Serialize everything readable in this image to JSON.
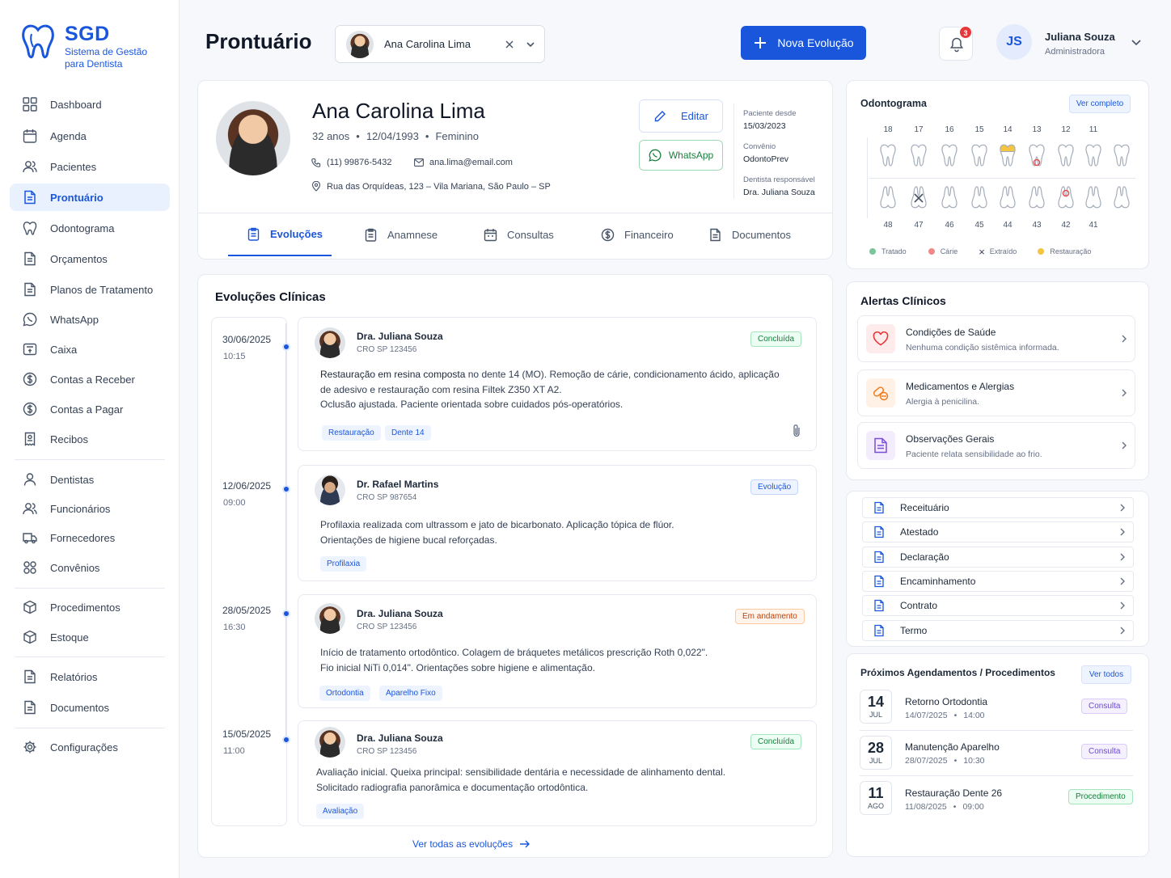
{
  "app": {
    "name": "SGD",
    "tagline_1": "Sistema de Gestão",
    "tagline_2": "para Dentista"
  },
  "sidebar": {
    "items": [
      {
        "label": "Dashboard",
        "icon": "grid-icon"
      },
      {
        "label": "Agenda",
        "icon": "calendar-icon"
      },
      {
        "label": "Pacientes",
        "icon": "users-icon"
      },
      {
        "label": "Prontuário",
        "icon": "file-icon",
        "active": true
      },
      {
        "label": "Odontograma",
        "icon": "tooth-icon"
      },
      {
        "label": "Orçamentos",
        "icon": "file-icon"
      },
      {
        "label": "Planos de Tratamento",
        "icon": "file-icon"
      },
      {
        "label": "WhatsApp",
        "icon": "whatsapp-icon"
      },
      {
        "label": "Caixa",
        "icon": "cash-icon"
      },
      {
        "label": "Contas a Receber",
        "icon": "dollar-icon"
      },
      {
        "label": "Contas a Pagar",
        "icon": "dollar-icon"
      },
      {
        "label": "Recibos",
        "icon": "receipt-icon"
      },
      {
        "label": "Dentistas",
        "icon": "user-icon"
      },
      {
        "label": "Funcionários",
        "icon": "users-icon"
      },
      {
        "label": "Fornecedores",
        "icon": "truck-icon"
      },
      {
        "label": "Convênios",
        "icon": "handshake-icon"
      },
      {
        "label": "Procedimentos",
        "icon": "box-icon"
      },
      {
        "label": "Estoque",
        "icon": "box-icon"
      },
      {
        "label": "Relatórios",
        "icon": "file-icon"
      },
      {
        "label": "Documentos",
        "icon": "file-icon"
      },
      {
        "label": "Configurações",
        "icon": "gear-icon"
      }
    ]
  },
  "header": {
    "title": "Prontuário",
    "patient_select": "Ana Carolina Lima",
    "new_button": "Nova Evolução",
    "notif_count": "3",
    "user_initials": "JS",
    "user_name": "Juliana Souza",
    "user_role": "Administradora"
  },
  "patient": {
    "name": "Ana Carolina Lima",
    "age": "32 anos",
    "birth": "12/04/1993",
    "gender": "Feminino",
    "phone": "(11) 99876-5432",
    "email": "ana.lima@email.com",
    "address": "Rua das Orquídeas, 123 – Vila Mariana, São Paulo – SP",
    "edit_label": "Editar",
    "whatsapp_label": "WhatsApp",
    "since_label": "Paciente desde",
    "since": "15/03/2023",
    "insurance_label": "Convênio",
    "insurance": "OdontoPrev",
    "dentist_label": "Dentista responsável",
    "dentist": "Dra. Juliana Souza"
  },
  "tabs": [
    "Evoluções",
    "Anamnese",
    "Consultas",
    "Financeiro",
    "Documentos"
  ],
  "evolutions": {
    "title": "Evoluções Clínicas",
    "items": [
      {
        "date": "30/06/2025",
        "time": "10:15",
        "doctor": "Dra. Juliana Souza",
        "cro": "CRO SP 123456",
        "status": "Concluída",
        "text_bold": "Restauração em resina composta",
        "line1": " no dente 14 (MO). Remoção de cárie, condicionamento ácido, aplicação",
        "line2": "de adesivo e restauração com resina Filtek Z350 XT A2.",
        "line3": "Oclusão ajustada. Paciente orientada sobre cuidados pós-operatórios.",
        "tags": [
          "Restauração",
          "Dente 14"
        ]
      },
      {
        "date": "12/06/2025",
        "time": "09:00",
        "doctor": "Dr. Rafael Martins",
        "cro": "CRO SP 987654",
        "status": "Evolução",
        "line1": "Profilaxia realizada com ultrassom e jato de bicarbonato. Aplicação tópica de flúor.",
        "line2": "Orientações de higiene bucal reforçadas.",
        "tags": [
          "Profilaxia"
        ]
      },
      {
        "date": "28/05/2025",
        "time": "16:30",
        "doctor": "Dra. Juliana Souza",
        "cro": "CRO SP 123456",
        "status": "Em andamento",
        "line1": "Início de tratamento ortodôntico. Colagem de bráquetes metálicos prescrição Roth 0,022\".",
        "line2": "Fio inicial NiTi 0,014\". Orientações sobre higiene e alimentação.",
        "tags": [
          "Ortodontia",
          "Aparelho Fixo"
        ]
      },
      {
        "date": "15/05/2025",
        "time": "11:00",
        "doctor": "Dra. Juliana Souza",
        "cro": "CRO SP 123456",
        "status": "Concluída",
        "line1": "Avaliação inicial. Queixa principal: sensibilidade dentária e necessidade de alinhamento dental.",
        "line2": "Solicitado radiografia panorâmica e documentação ortodôntica.",
        "tags": [
          "Avaliação"
        ]
      }
    ],
    "view_all": "Ver todas as evoluções"
  },
  "odontogram": {
    "title": "Odontograma",
    "view_full": "Ver completo",
    "upper": [
      "18",
      "17",
      "16",
      "15",
      "14",
      "13",
      "12",
      "11"
    ],
    "lower": [
      "48",
      "47",
      "46",
      "45",
      "44",
      "43",
      "42",
      "41"
    ],
    "legend": [
      "Tratado",
      "Cárie",
      "Extraído",
      "Restauração"
    ],
    "colors": {
      "treated": "#7cc49a",
      "caries": "#e5484d",
      "restoration": "#f5c542"
    }
  },
  "alerts": {
    "title": "Alertas Clínicos",
    "items": [
      {
        "title": "Condições de Saúde",
        "desc": "Nenhuma condição sistêmica informada."
      },
      {
        "title": "Medicamentos e Alergias",
        "desc": "Alergia à penicilina."
      },
      {
        "title": "Observações Gerais",
        "desc": "Paciente relata sensibilidade ao frio."
      }
    ]
  },
  "documents": [
    "Receituário",
    "Atestado",
    "Declaração",
    "Encaminhamento",
    "Contrato",
    "Termo"
  ],
  "appointments": {
    "title": "Próximos Agendamentos / Procedimentos",
    "view_all": "Ver todos",
    "items": [
      {
        "day": "14",
        "month": "JUL",
        "title": "Retorno Ortodontia",
        "date": "14/07/2025",
        "time": "14:00",
        "type": "Consulta"
      },
      {
        "day": "28",
        "month": "JUL",
        "title": "Manutenção Aparelho",
        "date": "28/07/2025",
        "time": "10:30",
        "type": "Consulta"
      },
      {
        "day": "11",
        "month": "AGO",
        "title": "Restauração Dente 26",
        "date": "11/08/2025",
        "time": "09:00",
        "type": "Procedimento"
      }
    ]
  }
}
